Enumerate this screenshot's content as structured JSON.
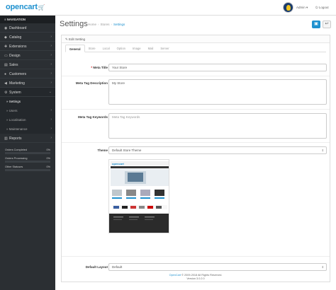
{
  "header": {
    "logo": "opencart",
    "user_menu": "Admin ▾",
    "logout": "Logout"
  },
  "sidebar": {
    "nav_title": "NAVIGATION",
    "items": [
      {
        "label": "Dashboard",
        "icon": "dashboard-icon",
        "has_children": false
      },
      {
        "label": "Catalog",
        "icon": "tag-icon",
        "has_children": true
      },
      {
        "label": "Extensions",
        "icon": "puzzle-icon",
        "has_children": true
      },
      {
        "label": "Design",
        "icon": "monitor-icon",
        "has_children": true
      },
      {
        "label": "Sales",
        "icon": "cart-icon",
        "has_children": true
      },
      {
        "label": "Customers",
        "icon": "user-icon",
        "has_children": true
      },
      {
        "label": "Marketing",
        "icon": "share-icon",
        "has_children": true
      },
      {
        "label": "System",
        "icon": "gear-icon",
        "has_children": true,
        "open": true
      }
    ],
    "system_children": [
      {
        "label": "Settings",
        "has_children": false,
        "current": true
      },
      {
        "label": "Users",
        "has_children": true
      },
      {
        "label": "Localisation",
        "has_children": true
      },
      {
        "label": "Maintenance",
        "has_children": true
      }
    ],
    "reports": {
      "label": "Reports",
      "icon": "bar-chart-icon"
    },
    "progress": [
      {
        "label": "Orders Completed",
        "value": "0%",
        "fraction": 0
      },
      {
        "label": "Orders Processing",
        "value": "0%",
        "fraction": 0
      },
      {
        "label": "Other Statuses",
        "value": "0%",
        "fraction": 0
      }
    ]
  },
  "page": {
    "title": "Settings",
    "breadcrumb": [
      "Home",
      "Stores",
      "Settings"
    ],
    "save_icon": "save-icon",
    "back_icon": "reply-icon"
  },
  "panel": {
    "heading": "Edit Setting",
    "tabs": [
      "General",
      "Store",
      "Local",
      "Option",
      "Image",
      "Mail",
      "Server"
    ],
    "active_tab": "General"
  },
  "form": {
    "meta_title": {
      "label": "Meta Title",
      "value": "Your Store",
      "required": true
    },
    "meta_description": {
      "label": "Meta Tag Description",
      "value": "My Store"
    },
    "meta_keywords": {
      "label": "Meta Tag Keywords",
      "placeholder": "Meta Tag Keywords"
    },
    "theme": {
      "label": "Theme",
      "value": "Default Store Theme"
    },
    "default_layout": {
      "label": "Default Layout",
      "value": "Default"
    }
  },
  "footer": {
    "link": "OpenCart",
    "copyright": " © 2009-2018 All Rights Reserved.",
    "version": "Version 3.0.2.0"
  },
  "colors": {
    "accent": "#1e91cf",
    "sidebar_bg": "#2b2f33",
    "active_item": "#1e91cf"
  }
}
